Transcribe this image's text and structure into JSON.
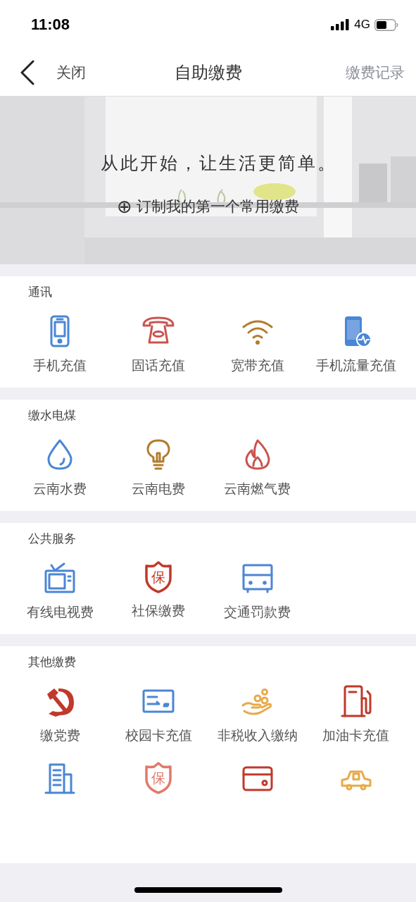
{
  "status_bar": {
    "time": "11:08",
    "network": "4G"
  },
  "nav": {
    "close": "关闭",
    "title": "自助缴费",
    "action": "缴费记录"
  },
  "banner": {
    "slogan": "从此开始，让生活更简单。",
    "add_icon": "⊕",
    "add_label": "订制我的第一个常用缴费"
  },
  "sections": [
    {
      "title": "通讯",
      "items": [
        {
          "label": "手机充值",
          "kind": "phone",
          "color": "#4a86d6"
        },
        {
          "label": "固话充值",
          "kind": "telephone",
          "color": "#c95450"
        },
        {
          "label": "宽带充值",
          "kind": "wifi",
          "color": "#b27c2c"
        },
        {
          "label": "手机流量充值",
          "kind": "phone-data",
          "color": "#4a86d6"
        }
      ]
    },
    {
      "title": "缴水电煤",
      "items": [
        {
          "label": "云南水费",
          "kind": "drop",
          "color": "#4a86d6"
        },
        {
          "label": "云南电费",
          "kind": "bulb",
          "color": "#b27c2c"
        },
        {
          "label": "云南燃气费",
          "kind": "flame",
          "color": "#c95450"
        }
      ]
    },
    {
      "title": "公共服务",
      "items": [
        {
          "label": "有线电视费",
          "kind": "tv",
          "color": "#4a86d6"
        },
        {
          "label": "社保缴费",
          "kind": "shield",
          "color": "#c0392b",
          "glyph": "保"
        },
        {
          "label": "交通罚款费",
          "kind": "cabinet",
          "color": "#4a86d6"
        }
      ]
    },
    {
      "title": "其他缴费",
      "items": [
        {
          "label": "缴党费",
          "kind": "emblem",
          "color": "#c0392b"
        },
        {
          "label": "校园卡充值",
          "kind": "card",
          "color": "#4a86d6"
        },
        {
          "label": "非税收入缴纳",
          "kind": "hand-coins",
          "color": "#e8a94a"
        },
        {
          "label": "加油卡充值",
          "kind": "fuel",
          "color": "#c0392b"
        },
        {
          "kind": "building",
          "color": "#4a86d6"
        },
        {
          "kind": "shield",
          "color": "#e07a6a",
          "glyph": "保"
        },
        {
          "kind": "bank-card",
          "color": "#c0392b"
        },
        {
          "kind": "car",
          "color": "#e8a94a"
        }
      ]
    }
  ]
}
